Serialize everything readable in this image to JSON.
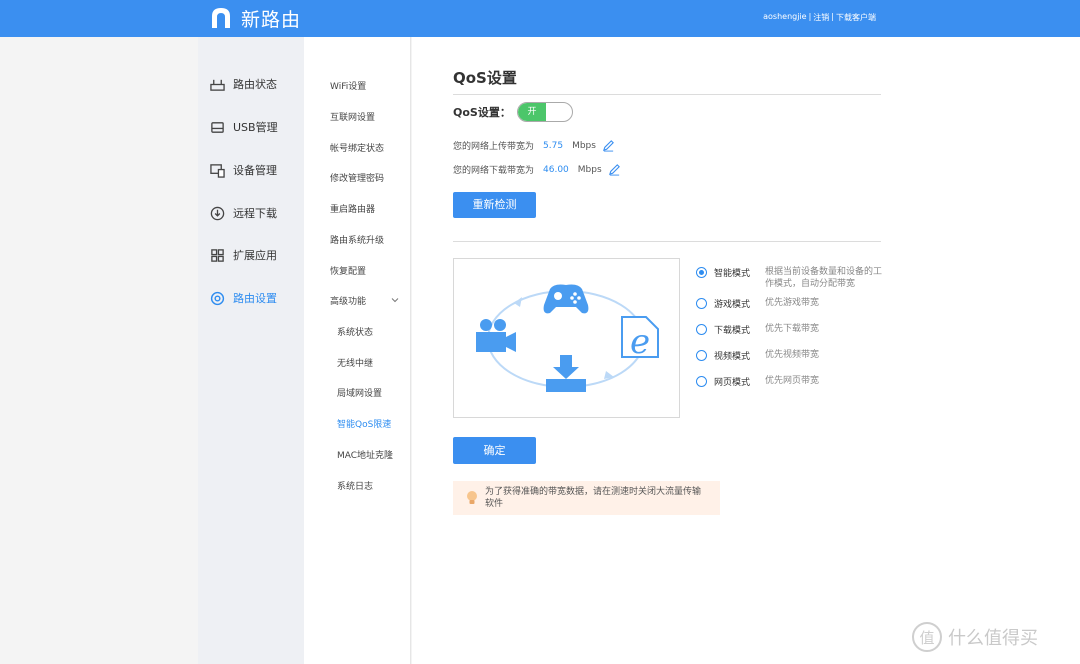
{
  "header": {
    "brand": "新路由",
    "user": "aoshengjie",
    "sep1": "|",
    "logout": "注销",
    "sep2": "|",
    "download_client": "下载客户端"
  },
  "sidebar": {
    "items": [
      {
        "label": "路由状态",
        "icon": "router-icon"
      },
      {
        "label": "USB管理",
        "icon": "usb-drive-icon"
      },
      {
        "label": "设备管理",
        "icon": "devices-icon"
      },
      {
        "label": "远程下载",
        "icon": "download-circle-icon"
      },
      {
        "label": "扩展应用",
        "icon": "apps-grid-icon"
      },
      {
        "label": "路由设置",
        "icon": "gear-icon",
        "active": true
      }
    ]
  },
  "submenu": {
    "items": [
      {
        "label": "WiFi设置"
      },
      {
        "label": "互联网设置"
      },
      {
        "label": "帐号绑定状态"
      },
      {
        "label": "修改管理密码"
      },
      {
        "label": "重启路由器"
      },
      {
        "label": "路由系统升级"
      },
      {
        "label": "恢复配置"
      },
      {
        "label": "高级功能",
        "expanded": true
      }
    ],
    "advanced": [
      {
        "label": "系统状态"
      },
      {
        "label": "无线中继"
      },
      {
        "label": "局域网设置"
      },
      {
        "label": "智能QoS限速",
        "active": true
      },
      {
        "label": "MAC地址克隆"
      },
      {
        "label": "系统日志"
      }
    ]
  },
  "qos": {
    "title": "QoS设置",
    "switch_label": "QoS设置：",
    "switch_state": "开",
    "upload_label": "您的网络上传带宽为",
    "upload_value": "5.75",
    "upload_unit": "Mbps",
    "download_label": "您的网络下载带宽为",
    "download_value": "46.00",
    "download_unit": "Mbps",
    "redetect_button": "重新检测",
    "modes": [
      {
        "name": "智能模式",
        "desc": "根据当前设备数量和设备的工作模式，自动分配带宽",
        "checked": true
      },
      {
        "name": "游戏模式",
        "desc": "优先游戏带宽",
        "checked": false
      },
      {
        "name": "下载模式",
        "desc": "优先下载带宽",
        "checked": false
      },
      {
        "name": "视频模式",
        "desc": "优先视频带宽",
        "checked": false
      },
      {
        "name": "网页模式",
        "desc": "优先网页带宽",
        "checked": false
      }
    ],
    "confirm_button": "确定",
    "tip": "为了获得准确的带宽数据，请在测速时关闭大流量传输软件"
  },
  "watermark": {
    "badge": "值",
    "text": "什么值得买"
  },
  "colors": {
    "accent": "#3b8ff0",
    "toggle_on": "#4cc66a",
    "tip_bg": "#fff1e8",
    "illustration": "#4a9cf0"
  }
}
